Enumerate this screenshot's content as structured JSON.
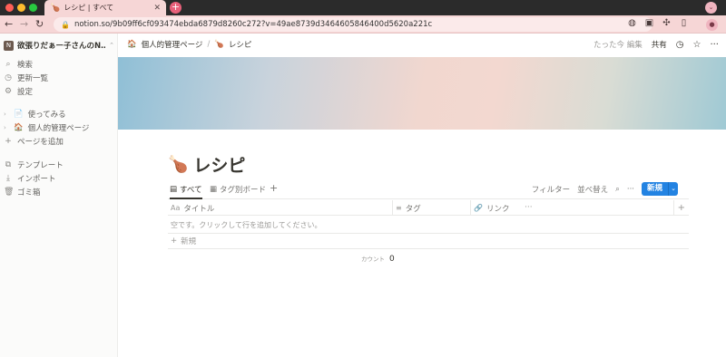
{
  "browser": {
    "tab_title": "レシピ | すべて",
    "tab_icon": "🍗",
    "new_tab": "+",
    "url": "notion.so/9b09ff6cf093474ebda6879d8260c272?v=49ae8739d3464605846400d5620a221c",
    "profile_initial": "●"
  },
  "sidebar": {
    "workspace_name": "欲張りだぁー子さんのN…",
    "workspace_initial": "N",
    "top_items": [
      {
        "label": "検索",
        "icon": "search-icon"
      },
      {
        "label": "更新一覧",
        "icon": "clock-icon"
      },
      {
        "label": "設定",
        "icon": "gear-icon"
      }
    ],
    "pages": [
      {
        "label": "使ってみる",
        "icon": "📄"
      },
      {
        "label": "個人的管理ページ",
        "icon": "🏠"
      }
    ],
    "add_page": "ページを追加",
    "bottom_items": [
      {
        "label": "テンプレート",
        "icon": "template-icon"
      },
      {
        "label": "インポート",
        "icon": "import-icon"
      },
      {
        "label": "ゴミ箱",
        "icon": "trash-icon"
      }
    ]
  },
  "topbar": {
    "crumb_parent": "個人的管理ページ",
    "crumb_parent_icon": "🏠",
    "crumb_current": "レシピ",
    "crumb_current_icon": "🍗",
    "edited": "たった今 編集",
    "share": "共有"
  },
  "page": {
    "icon": "🍗",
    "title": "レシピ"
  },
  "views": {
    "tabs": [
      "すべて",
      "タグ別ボード"
    ],
    "filter": "フィルター",
    "sort": "並べ替え",
    "new_label": "新規"
  },
  "table": {
    "columns": [
      {
        "label": "タイトル",
        "icon": "Aa"
      },
      {
        "label": "タグ",
        "icon": "≡"
      },
      {
        "label": "リンク",
        "icon": "🔗"
      }
    ],
    "empty_text": "空です。クリックして行を追加してください。",
    "add_row": "新規",
    "count_label": "カウント",
    "count_value": "0"
  },
  "colors": {
    "accent": "#2383e2",
    "chrome": "#f6d6d6",
    "sidebar_bg": "#fbfbfa"
  }
}
